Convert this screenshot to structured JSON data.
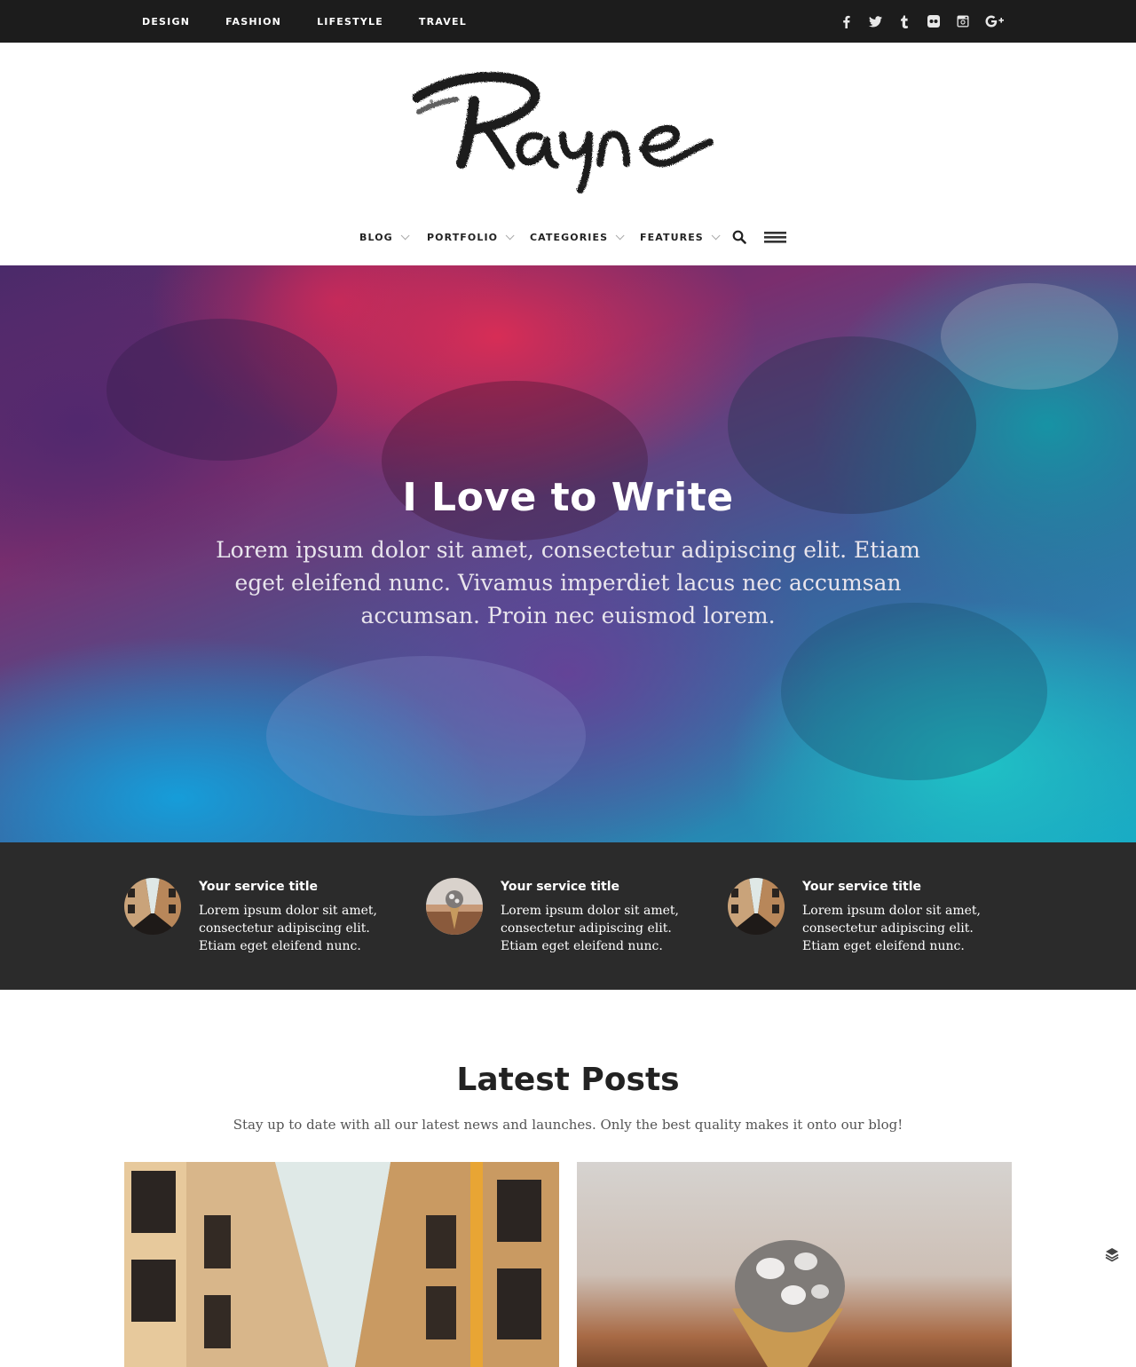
{
  "topbar": {
    "nav": [
      "DESIGN",
      "FASHION",
      "LIFESTYLE",
      "TRAVEL"
    ],
    "social_icons": [
      "facebook-icon",
      "twitter-icon",
      "tumblr-icon",
      "flickr-icon",
      "instagram-icon",
      "google-plus-icon"
    ]
  },
  "logo": {
    "text": "Rayne"
  },
  "mainnav": {
    "items": [
      "BLOG",
      "PORTFOLIO",
      "CATEGORIES",
      "FEATURES"
    ],
    "icons": [
      "search-icon",
      "menu-icon"
    ]
  },
  "hero": {
    "title": "I Love to Write",
    "text": "Lorem ipsum dolor sit amet, consectetur adipiscing elit. Etiam eget eleifend nunc. Vivamus imperdiet lacus nec accumsan accumsan. Proin nec euismod lorem."
  },
  "services": [
    {
      "title": "Your service title",
      "desc": "Lorem ipsum dolor sit amet, consectetur adipiscing elit. Etiam eget eleifend nunc.",
      "image": "street"
    },
    {
      "title": "Your service title",
      "desc": "Lorem ipsum dolor sit amet, consectetur adipiscing elit. Etiam eget eleifend nunc.",
      "image": "ice-cream"
    },
    {
      "title": "Your service title",
      "desc": "Lorem ipsum dolor sit amet, consectetur adipiscing elit. Etiam eget eleifend nunc.",
      "image": "street"
    }
  ],
  "latest": {
    "title": "Latest Posts",
    "subtitle": "Stay up to date with all our latest news and launches. Only the best quality makes it onto our blog!"
  },
  "colors": {
    "topbar": "#1c1c1c",
    "services_bg": "#2b2b2b",
    "hero_pink": "#dc2d55",
    "hero_teal": "#17a6c4"
  }
}
